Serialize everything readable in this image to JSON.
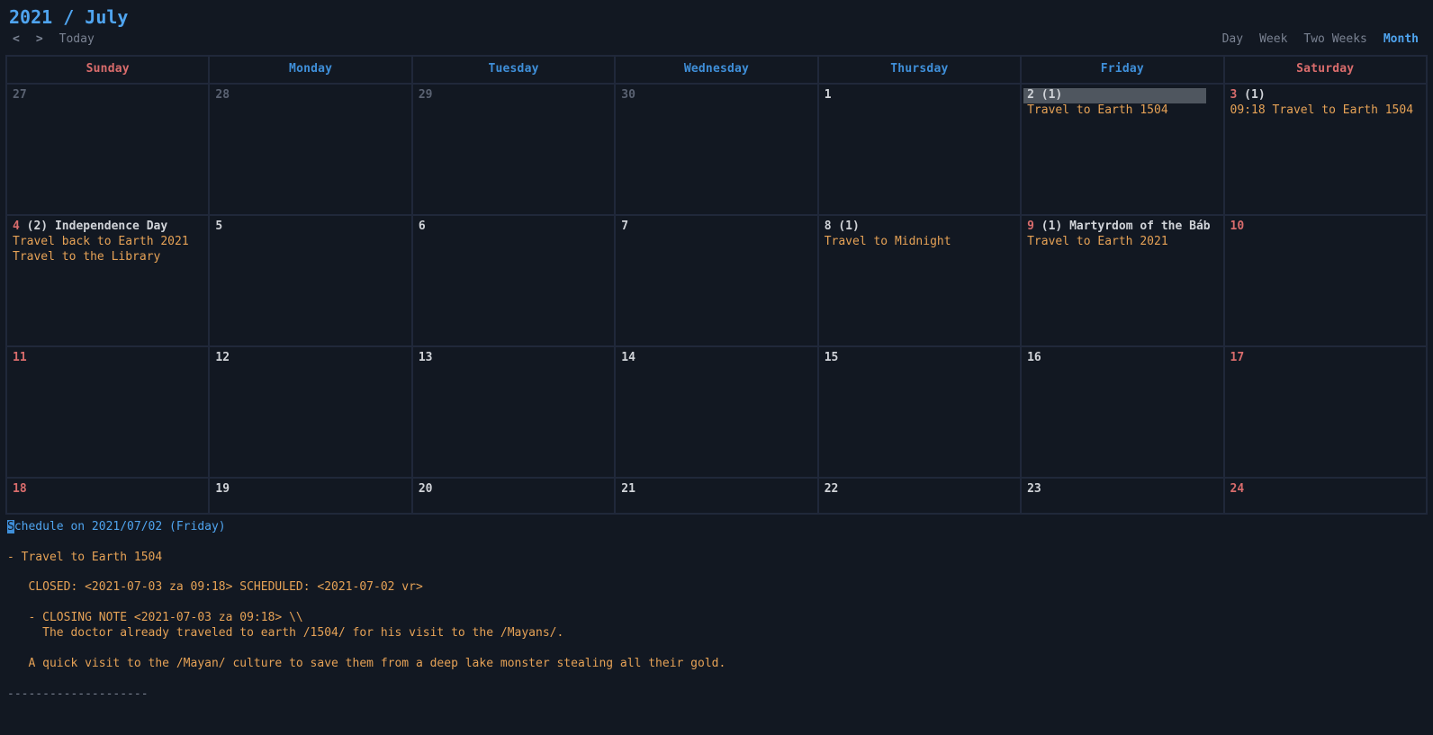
{
  "header": {
    "title": "2021 / July"
  },
  "nav": {
    "prev": "<",
    "next": ">",
    "today": "Today",
    "views": {
      "day": "Day",
      "week": "Week",
      "two_weeks": "Two Weeks",
      "month": "Month"
    },
    "active": "month"
  },
  "weekdays": [
    "Sunday",
    "Monday",
    "Tuesday",
    "Wednesday",
    "Thursday",
    "Friday",
    "Saturday"
  ],
  "weekend_indexes": [
    0,
    6
  ],
  "rows": [
    [
      {
        "num": "27",
        "other": true
      },
      {
        "num": "28",
        "other": true
      },
      {
        "num": "29",
        "other": true
      },
      {
        "num": "30",
        "other": true
      },
      {
        "num": "1"
      },
      {
        "num": "2",
        "count": "(1)",
        "selected": true,
        "events": [
          "Travel to Earth 1504"
        ]
      },
      {
        "num": "3",
        "count": "(1)",
        "red": true,
        "events": [
          "09:18 Travel to Earth 1504"
        ]
      }
    ],
    [
      {
        "num": "4",
        "count": "(2)",
        "red": true,
        "holiday": "Independence Day",
        "events": [
          "Travel back to Earth 2021",
          "Travel to the Library"
        ]
      },
      {
        "num": "5"
      },
      {
        "num": "6"
      },
      {
        "num": "7"
      },
      {
        "num": "8",
        "count": "(1)",
        "events": [
          "Travel to Midnight"
        ]
      },
      {
        "num": "9",
        "count": "(1)",
        "red": true,
        "holiday": "Martyrdom of the Báb",
        "events": [
          "Travel to Earth 2021"
        ]
      },
      {
        "num": "10",
        "red": true
      }
    ],
    [
      {
        "num": "11",
        "red": true
      },
      {
        "num": "12"
      },
      {
        "num": "13"
      },
      {
        "num": "14"
      },
      {
        "num": "15"
      },
      {
        "num": "16"
      },
      {
        "num": "17",
        "red": true
      }
    ],
    [
      {
        "num": "18",
        "red": true
      },
      {
        "num": "19"
      },
      {
        "num": "20"
      },
      {
        "num": "21"
      },
      {
        "num": "22"
      },
      {
        "num": "23"
      },
      {
        "num": "24",
        "red": true
      }
    ]
  ],
  "detail": {
    "title_cursor": "S",
    "title_rest": "chedule on 2021/07/02 (Friday)",
    "lines": [
      "",
      "- Travel to Earth 1504",
      "",
      "   CLOSED: <2021-07-03 za 09:18> SCHEDULED: <2021-07-02 vr>",
      "",
      "   - CLOSING NOTE <2021-07-03 za 09:18> \\\\",
      "     The doctor already traveled to earth /1504/ for his visit to the /Mayans/.",
      "",
      "   A quick visit to the /Mayan/ culture to save them from a deep lake monster stealing all their gold.",
      "",
      "--------------------"
    ]
  }
}
